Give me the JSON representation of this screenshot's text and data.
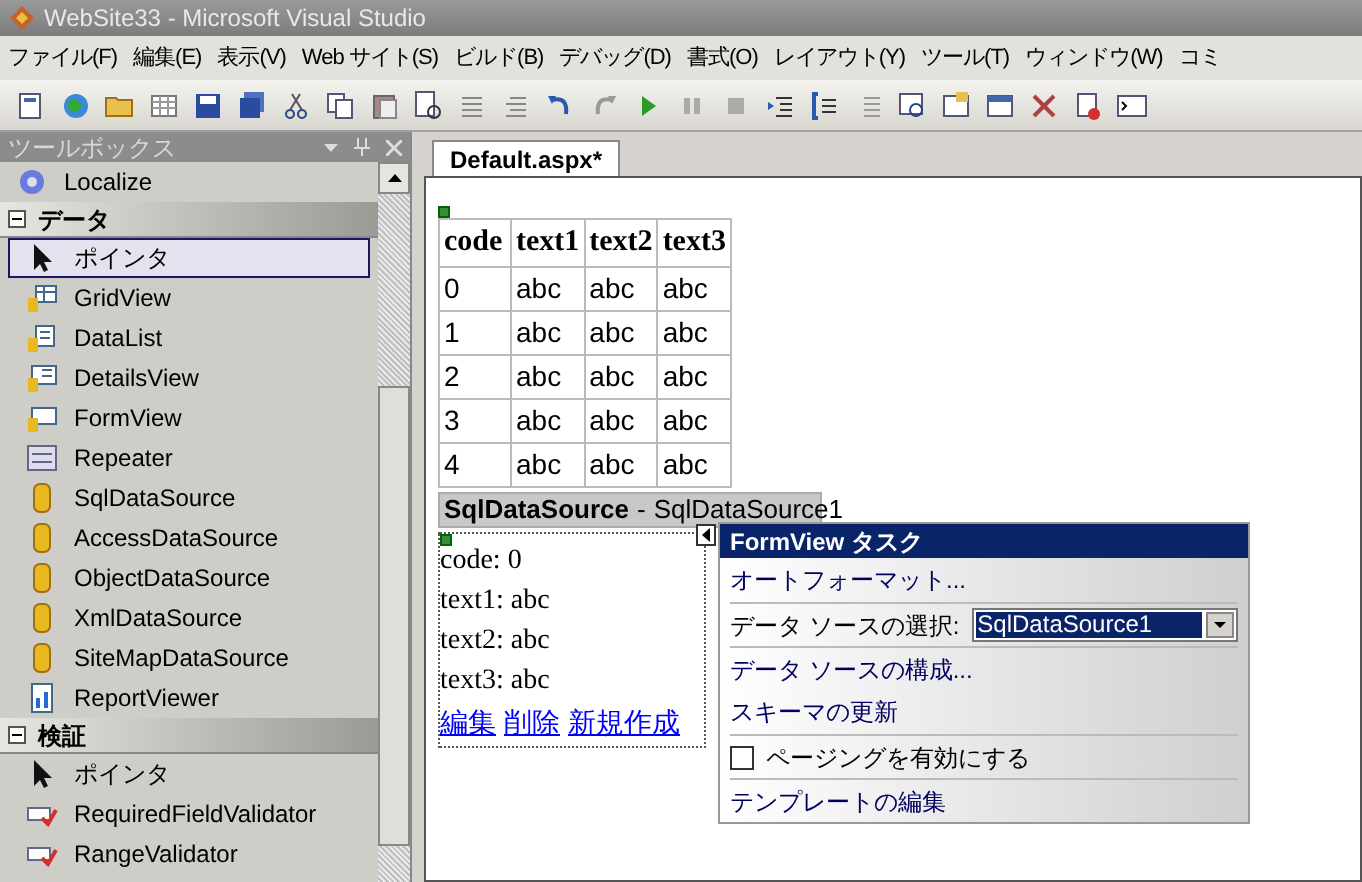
{
  "window": {
    "title": "WebSite33 - Microsoft Visual Studio"
  },
  "menu": [
    "ファイル(F)",
    "編集(E)",
    "表示(V)",
    "Web サイト(S)",
    "ビルド(B)",
    "デバッグ(D)",
    "書式(O)",
    "レイアウト(Y)",
    "ツール(T)",
    "ウィンドウ(W)",
    "コミ"
  ],
  "toolbox": {
    "title": "ツールボックス",
    "top_item": "Localize",
    "categories": [
      {
        "label": "データ",
        "expanded": true,
        "items": [
          {
            "label": "ポインタ",
            "kind": "pointer",
            "selected": true
          },
          {
            "label": "GridView",
            "kind": "grid",
            "selected": false
          },
          {
            "label": "DataList",
            "kind": "list",
            "selected": false
          },
          {
            "label": "DetailsView",
            "kind": "details",
            "selected": false
          },
          {
            "label": "FormView",
            "kind": "form",
            "selected": false
          },
          {
            "label": "Repeater",
            "kind": "repeater",
            "selected": false
          },
          {
            "label": "SqlDataSource",
            "kind": "source",
            "selected": false
          },
          {
            "label": "AccessDataSource",
            "kind": "source",
            "selected": false
          },
          {
            "label": "ObjectDataSource",
            "kind": "source",
            "selected": false
          },
          {
            "label": "XmlDataSource",
            "kind": "source",
            "selected": false
          },
          {
            "label": "SiteMapDataSource",
            "kind": "source",
            "selected": false
          },
          {
            "label": "ReportViewer",
            "kind": "report",
            "selected": false
          }
        ]
      },
      {
        "label": "検証",
        "expanded": true,
        "items": [
          {
            "label": "ポインタ",
            "kind": "pointer",
            "selected": false
          },
          {
            "label": "RequiredFieldValidator",
            "kind": "validator",
            "selected": false
          },
          {
            "label": "RangeValidator",
            "kind": "validator",
            "selected": false
          }
        ]
      }
    ]
  },
  "tabs": [
    {
      "label": "Default.aspx*",
      "selected": true
    }
  ],
  "grid": {
    "columns": [
      "code",
      "text1",
      "text2",
      "text3"
    ],
    "rows": [
      [
        "0",
        "abc",
        "abc",
        "abc"
      ],
      [
        "1",
        "abc",
        "abc",
        "abc"
      ],
      [
        "2",
        "abc",
        "abc",
        "abc"
      ],
      [
        "3",
        "abc",
        "abc",
        "abc"
      ],
      [
        "4",
        "abc",
        "abc",
        "abc"
      ]
    ]
  },
  "datasource": {
    "type": "SqlDataSource",
    "separator": "-",
    "name": "SqlDataSource1"
  },
  "formview": {
    "fields": [
      "code: 0",
      "text1: abc",
      "text2: abc",
      "text3: abc"
    ],
    "links": [
      "編集",
      "削除",
      "新規作成"
    ]
  },
  "smart_tag": {
    "title": "FormView タスク",
    "items": [
      {
        "kind": "link",
        "label": "オートフォーマット..."
      },
      {
        "kind": "select",
        "label": "データ ソースの選択:",
        "value": "SqlDataSource1"
      },
      {
        "kind": "link",
        "label": "データ ソースの構成..."
      },
      {
        "kind": "link",
        "label": "スキーマの更新"
      },
      {
        "kind": "checkbox",
        "label": "ページングを有効にする",
        "checked": false
      },
      {
        "kind": "link",
        "label": "テンプレートの編集"
      }
    ]
  }
}
